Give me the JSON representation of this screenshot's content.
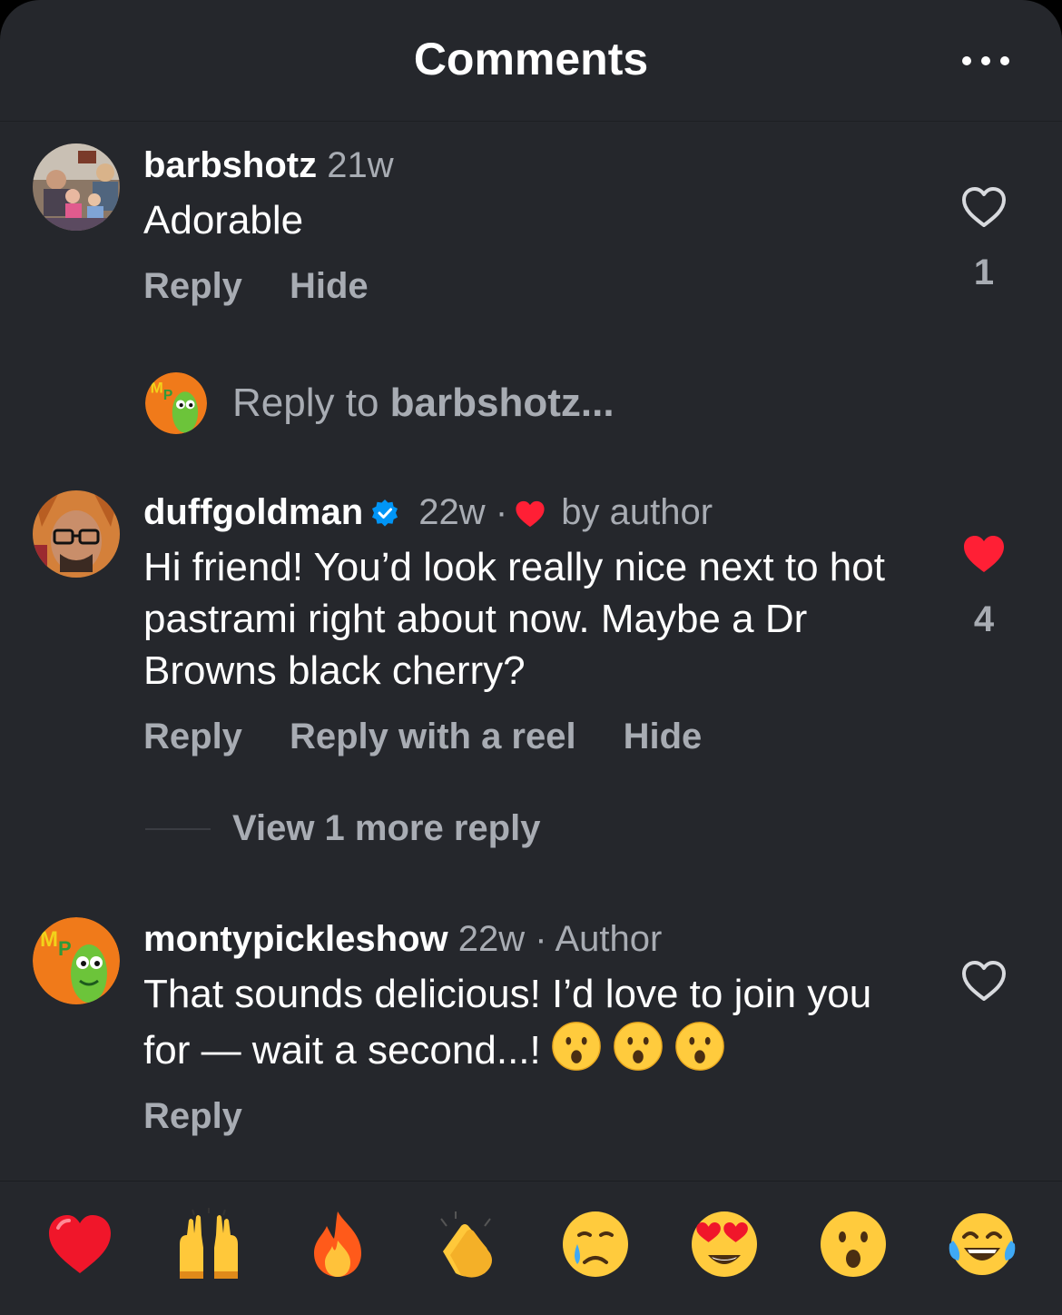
{
  "header": {
    "title": "Comments",
    "more_icon": "more-horizontal-icon"
  },
  "comments": [
    {
      "username": "barbshotz",
      "time": "21w",
      "text": "Adorable",
      "actions": [
        "Reply",
        "Hide"
      ],
      "likes": "1",
      "liked": false
    },
    {
      "username": "duffgoldman",
      "verified": true,
      "time": "22w",
      "dot": "·",
      "liked_by": "by author",
      "text": "Hi friend! You’d look really nice next to hot pastrami right about now. Maybe a Dr Browns black cherry?",
      "actions": [
        "Reply",
        "Reply with a reel",
        "Hide"
      ],
      "likes": "4",
      "liked": true
    },
    {
      "username": "montypickleshow",
      "time": "22w",
      "dot": "·",
      "badge": "Author",
      "text": "That sounds delicious! I’d love to join you for — wait a second...!",
      "text_emoji": [
        "astonished-face-emoji",
        "astonished-face-emoji",
        "astonished-face-emoji"
      ],
      "actions": [
        "Reply"
      ],
      "liked": false
    }
  ],
  "reply_prompt": {
    "prefix": "Reply to ",
    "username": "barbshotz",
    "suffix": "..."
  },
  "view_more": "View 1 more reply",
  "emoji_bar": [
    "red-heart",
    "raising-hands",
    "fire",
    "clapping-hands",
    "crying-face",
    "heart-eyes",
    "astonished-face",
    "tears-of-joy"
  ],
  "colors": {
    "background": "#25272c",
    "muted": "#a8acb3",
    "like_red": "#ff3040",
    "verified_blue": "#0095f6"
  }
}
